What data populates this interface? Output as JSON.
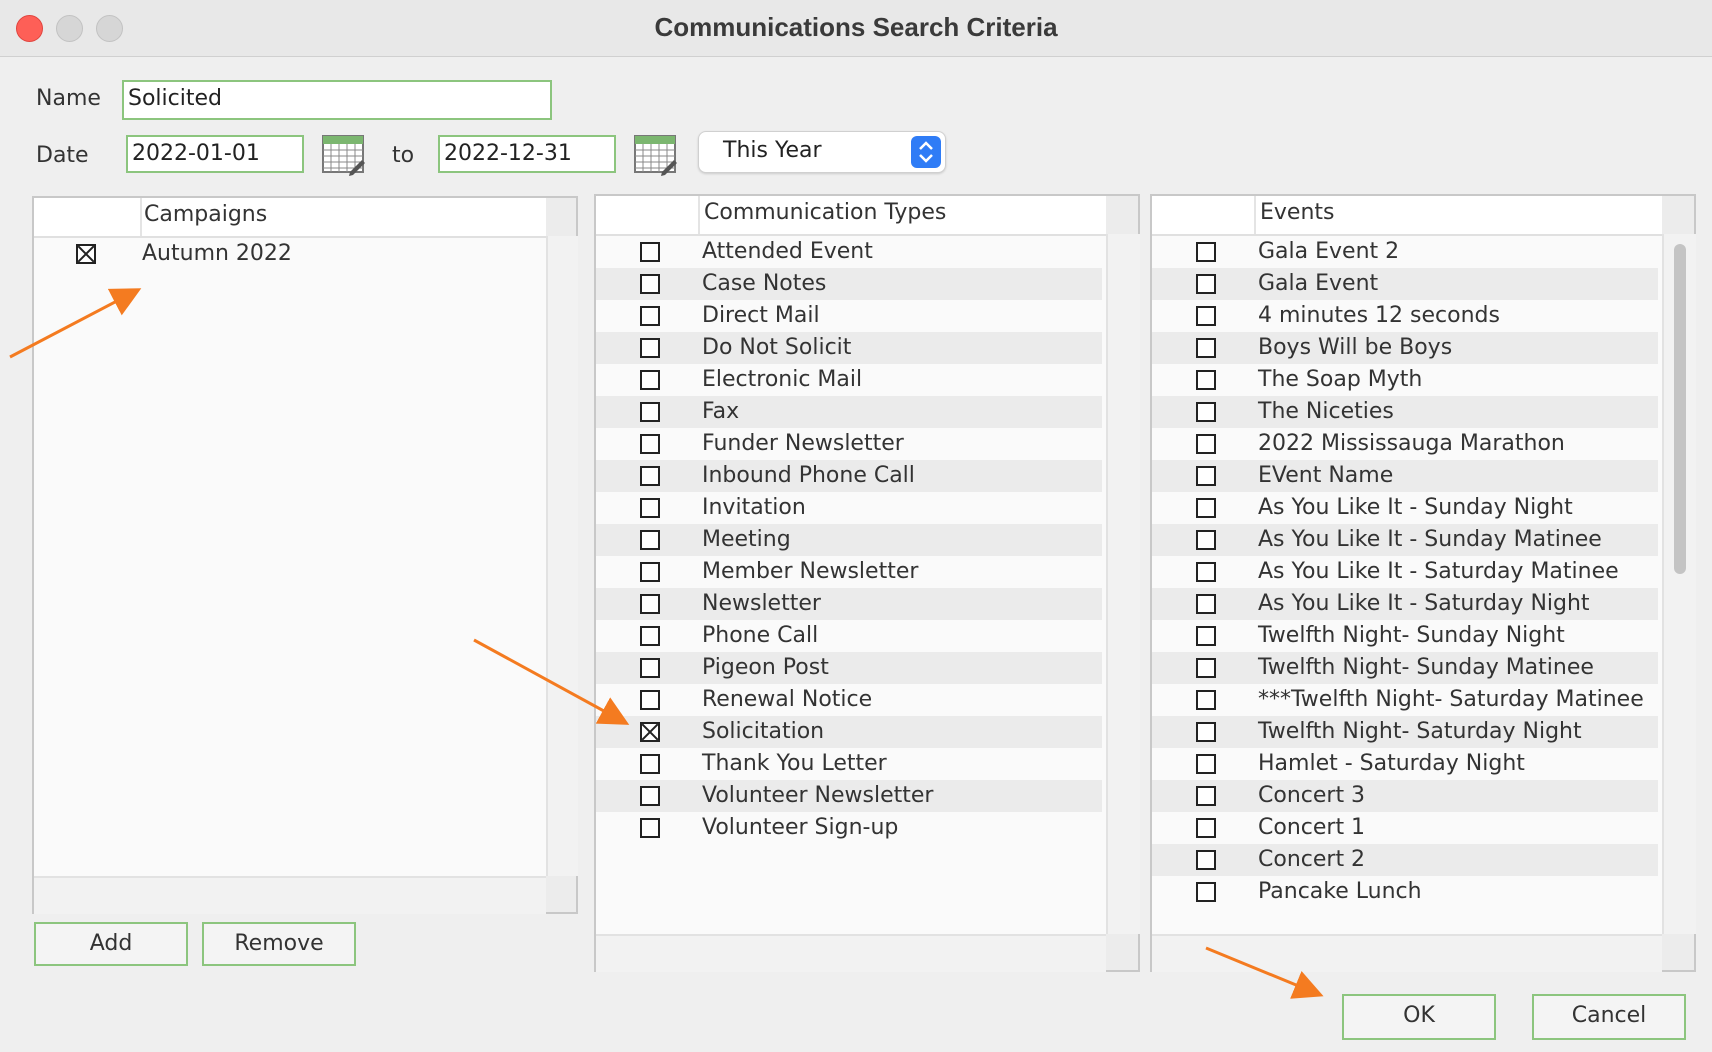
{
  "window": {
    "title": "Communications Search Criteria"
  },
  "form": {
    "name_label": "Name",
    "name_value": "Solicited",
    "date_label": "Date",
    "date_from": "2022-01-01",
    "to_label": "to",
    "date_to": "2022-12-31",
    "range_select": "This Year"
  },
  "campaigns": {
    "header": "Campaigns",
    "items": [
      {
        "label": "Autumn 2022",
        "checked": true
      }
    ],
    "add_label": "Add",
    "remove_label": "Remove"
  },
  "communication_types": {
    "header": "Communication Types",
    "items": [
      {
        "label": "Attended Event",
        "checked": false
      },
      {
        "label": "Case Notes",
        "checked": false
      },
      {
        "label": "Direct Mail",
        "checked": false
      },
      {
        "label": "Do Not Solicit",
        "checked": false
      },
      {
        "label": "Electronic Mail",
        "checked": false
      },
      {
        "label": "Fax",
        "checked": false
      },
      {
        "label": "Funder Newsletter",
        "checked": false
      },
      {
        "label": "Inbound Phone Call",
        "checked": false
      },
      {
        "label": "Invitation",
        "checked": false
      },
      {
        "label": "Meeting",
        "checked": false
      },
      {
        "label": "Member Newsletter",
        "checked": false
      },
      {
        "label": "Newsletter",
        "checked": false
      },
      {
        "label": "Phone Call",
        "checked": false
      },
      {
        "label": "Pigeon Post",
        "checked": false
      },
      {
        "label": "Renewal Notice",
        "checked": false
      },
      {
        "label": "Solicitation",
        "checked": true
      },
      {
        "label": "Thank You Letter",
        "checked": false
      },
      {
        "label": "Volunteer Newsletter",
        "checked": false
      },
      {
        "label": "Volunteer Sign-up",
        "checked": false
      }
    ]
  },
  "events": {
    "header": "Events",
    "items": [
      {
        "label": "Gala Event 2",
        "checked": false
      },
      {
        "label": "Gala Event",
        "checked": false
      },
      {
        "label": "4 minutes 12 seconds",
        "checked": false
      },
      {
        "label": "Boys Will be Boys",
        "checked": false
      },
      {
        "label": "The Soap Myth",
        "checked": false
      },
      {
        "label": "The Niceties",
        "checked": false
      },
      {
        "label": "2022 Mississauga Marathon",
        "checked": false
      },
      {
        "label": "EVent Name",
        "checked": false
      },
      {
        "label": "As You Like It - Sunday Night",
        "checked": false
      },
      {
        "label": "As You Like It - Sunday Matinee",
        "checked": false
      },
      {
        "label": "As You Like It - Saturday Matinee",
        "checked": false
      },
      {
        "label": "As You Like It - Saturday Night",
        "checked": false
      },
      {
        "label": "Twelfth Night- Sunday Night",
        "checked": false
      },
      {
        "label": "Twelfth Night- Sunday Matinee",
        "checked": false
      },
      {
        "label": "***Twelfth Night- Saturday Matinee",
        "checked": false
      },
      {
        "label": "Twelfth Night- Saturday Night",
        "checked": false
      },
      {
        "label": "Hamlet - Saturday Night",
        "checked": false
      },
      {
        "label": "Concert 3",
        "checked": false
      },
      {
        "label": "Concert 1",
        "checked": false
      },
      {
        "label": "Concert 2",
        "checked": false
      },
      {
        "label": "Pancake Lunch",
        "checked": false
      }
    ]
  },
  "footer": {
    "ok_label": "OK",
    "cancel_label": "Cancel"
  },
  "colors": {
    "field_border": "#8cc57e",
    "select_accent": "#2f7cf6",
    "annotation_arrow": "#f47b20",
    "close_button": "#fe5f57"
  },
  "icons": {
    "calendar": "calendar-icon",
    "select": "chevron-updown-icon",
    "close": "close-window-icon",
    "checkbox": "checkbox-icon"
  }
}
